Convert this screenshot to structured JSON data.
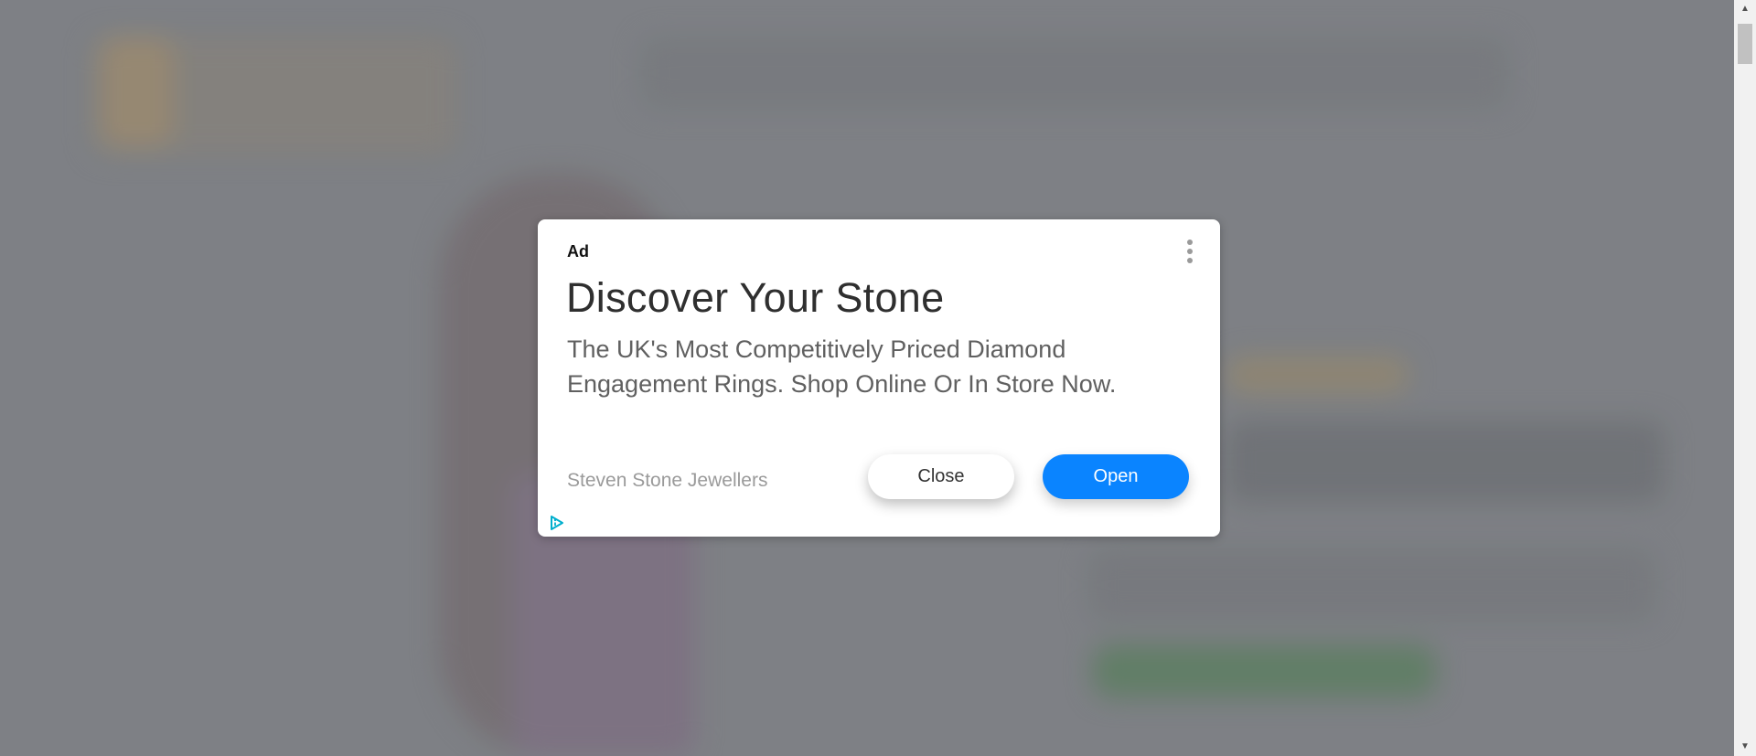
{
  "ad": {
    "label": "Ad",
    "title": "Discover Your Stone",
    "body": "The UK's Most Competitively Priced Diamond Engagement Rings. Shop Online Or In Store Now.",
    "advertiser": "Steven Stone Jewellers",
    "close_label": "Close",
    "open_label": "Open",
    "menu_icon": "more-vert-icon",
    "adchoices_icon": "adchoices-icon",
    "accent_color": "#0a84ff"
  },
  "scrollbar": {
    "up_arrow": "▲",
    "down_arrow": "▼"
  }
}
